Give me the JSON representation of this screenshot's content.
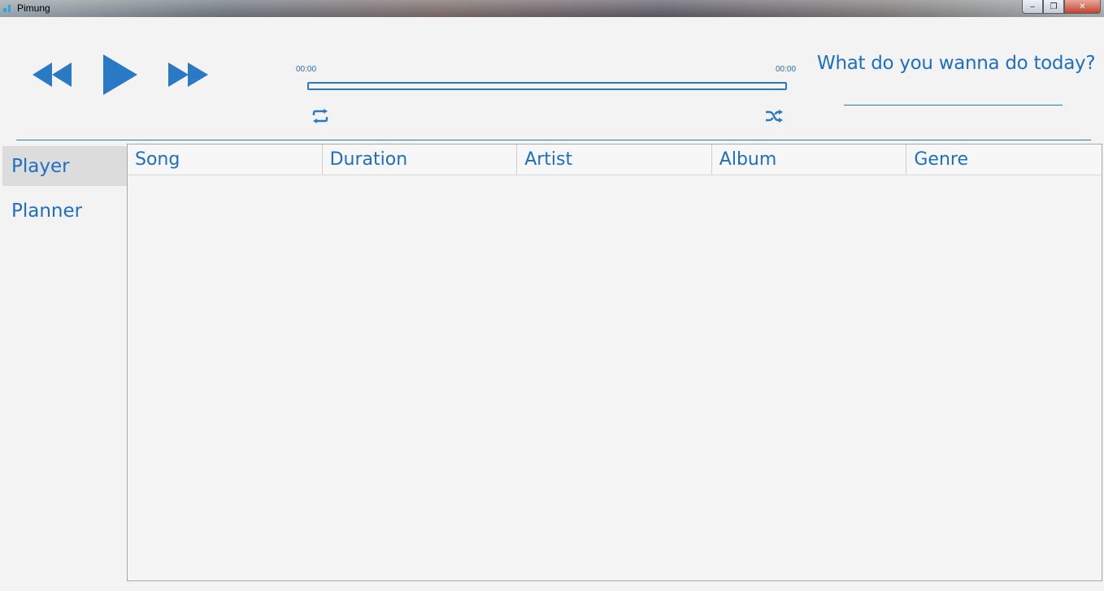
{
  "window": {
    "title": "Pimung",
    "minimize_label": "‒",
    "maximize_label": "❐",
    "close_label": "✕"
  },
  "player": {
    "time_current": "00:00",
    "time_total": "00:00",
    "progress": 0,
    "icons": {
      "rewind": "rewind-icon",
      "play": "play-icon",
      "fast_forward": "fast-forward-icon",
      "repeat": "repeat-icon",
      "shuffle": "shuffle-icon"
    }
  },
  "prompt": {
    "question": "What do you wanna do today?",
    "input_value": ""
  },
  "sidebar": {
    "items": [
      {
        "label": "Player",
        "active": true
      },
      {
        "label": "Planner",
        "active": false
      }
    ]
  },
  "table": {
    "columns": [
      "Song",
      "Duration",
      "Artist",
      "Album",
      "Genre"
    ],
    "rows": []
  },
  "colors": {
    "accent": "#1f6fc0",
    "background": "#f3f3f3"
  }
}
